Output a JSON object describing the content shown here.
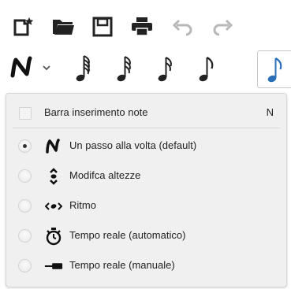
{
  "toolbar": {
    "buttons": [
      {
        "name": "new-score-icon"
      },
      {
        "name": "open-folder-icon"
      },
      {
        "name": "save-icon"
      },
      {
        "name": "print-icon"
      },
      {
        "name": "undo-icon"
      },
      {
        "name": "redo-icon"
      }
    ]
  },
  "note_toolbar": {
    "mode_icon": "note-input-n-icon",
    "dropdown_icon": "chevron-down-icon",
    "durations": [
      "64th-note-icon",
      "32nd-note-icon",
      "16th-note-icon",
      "eighth-note-icon",
      "quarter-note-icon"
    ],
    "selected_duration": "quarter-note-icon",
    "accent_color": "#2a6fb7"
  },
  "menu": {
    "toggle": {
      "label": "Barra inserimento note",
      "shortcut": "N",
      "checked": false
    },
    "options": [
      {
        "label": "Un passo alla volta (default)",
        "icon": "step-time-n-icon",
        "selected": true
      },
      {
        "label": "Modifca altezze",
        "icon": "repitch-arrows-icon",
        "selected": false
      },
      {
        "label": "Ritmo",
        "icon": "rhythm-icon",
        "selected": false
      },
      {
        "label": "Tempo reale (automatico)",
        "icon": "stopwatch-icon",
        "selected": false
      },
      {
        "label": "Tempo reale (manuale)",
        "icon": "key-pedal-icon",
        "selected": false
      }
    ]
  }
}
